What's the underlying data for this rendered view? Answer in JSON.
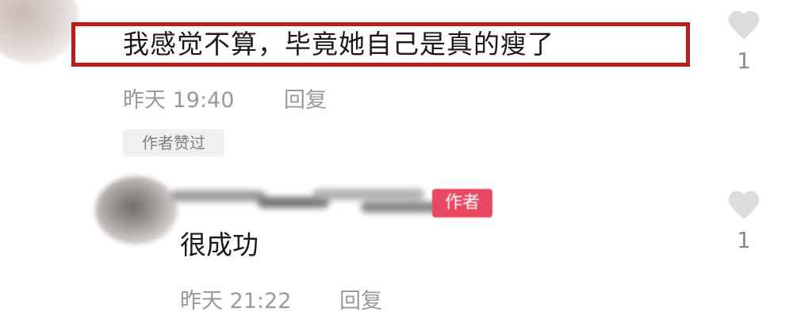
{
  "comments": [
    {
      "text": "我感觉不算，毕竟她自己是真的瘦了",
      "time": "昨天 19:40",
      "reply_label": "回复",
      "badge": "作者赞过",
      "like_count": "1"
    },
    {
      "author_badge": "作者",
      "text": "很成功",
      "time": "昨天 21:22",
      "reply_label": "回复",
      "like_count": "1"
    }
  ],
  "colors": {
    "highlight_border": "#b81c1c",
    "heart_gray": "#dcdcdc",
    "author_badge_bg": "#ea4763",
    "meta_text": "#9a9a9a"
  }
}
